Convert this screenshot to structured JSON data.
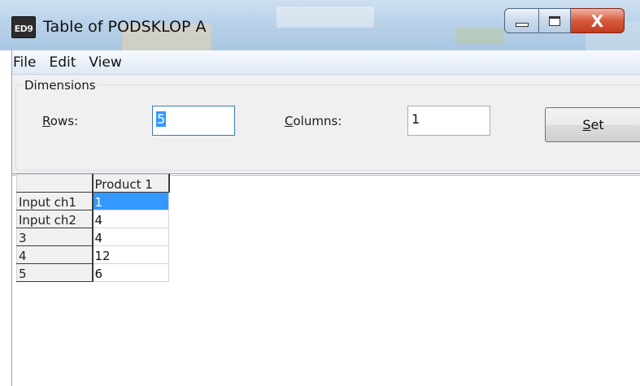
{
  "window": {
    "icon_text": "ED9",
    "title": "Table of PODSKLOP A",
    "caption_buttons": [
      "minimize",
      "maximize",
      "close"
    ],
    "close_glyph": "X"
  },
  "menu": {
    "items": [
      "File",
      "Edit",
      "View"
    ]
  },
  "dimensions": {
    "legend": "Dimensions",
    "rows_label_accel": "R",
    "rows_label_rest": "ows:",
    "rows_value": "5",
    "columns_label_accel": "C",
    "columns_label_rest": "olumns:",
    "columns_value": "1",
    "set_accel": "S",
    "set_rest": "et"
  },
  "grid": {
    "column_headers": [
      "Product 1"
    ],
    "rows": [
      {
        "header": "Input ch1",
        "values": [
          "1"
        ]
      },
      {
        "header": "Input ch2",
        "values": [
          "4"
        ]
      },
      {
        "header": "3",
        "values": [
          "4"
        ]
      },
      {
        "header": "4",
        "values": [
          "12"
        ]
      },
      {
        "header": "5",
        "values": [
          "6"
        ]
      }
    ],
    "selected_cell": {
      "row": 0,
      "col": 0
    },
    "selection_color": "#3399ff"
  },
  "colors": {
    "titlebar": "#b9d2e9",
    "close_button": "#d85a3e",
    "panel_background": "#f0f0f0"
  }
}
